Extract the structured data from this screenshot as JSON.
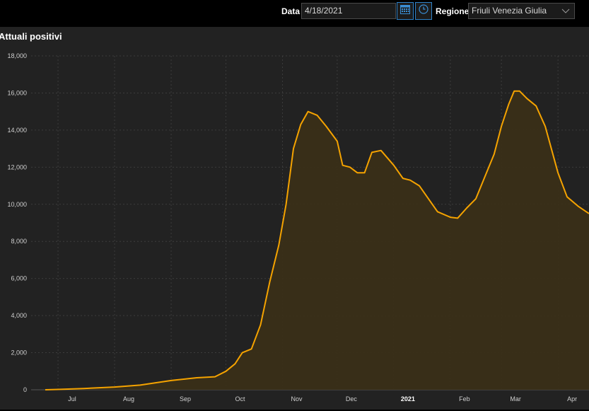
{
  "toolbar": {
    "date_label": "Data",
    "date_value": "4/18/2021",
    "region_label": "Regione",
    "region_value": "Friuli Venezia Giulia",
    "calendar_icon": "calendar-icon",
    "clock_icon": "clock-icon"
  },
  "panel": {
    "title": "Attuali positivi"
  },
  "colors": {
    "line": "#f5a300",
    "fill": "#3a2f18",
    "grid": "#3c3c3c",
    "accent": "#2f82c8"
  },
  "chart_data": {
    "type": "area",
    "title": "Attuali positivi",
    "xlabel": "",
    "ylabel": "",
    "ylim": [
      0,
      18000
    ],
    "yticks": [
      "0",
      "2,000",
      "4,000",
      "6,000",
      "8,000",
      "10,000",
      "12,000",
      "14,000",
      "16,000",
      "18,000"
    ],
    "xticks": [
      "Jul",
      "Aug",
      "Sep",
      "Oct",
      "Nov",
      "Dec",
      "2021",
      "Feb",
      "Mar",
      "Apr"
    ],
    "grid": true,
    "x": [
      "2020-06-24",
      "2020-07-01",
      "2020-07-15",
      "2020-08-01",
      "2020-08-15",
      "2020-09-01",
      "2020-09-15",
      "2020-09-25",
      "2020-10-01",
      "2020-10-06",
      "2020-10-10",
      "2020-10-15",
      "2020-10-20",
      "2020-10-25",
      "2020-10-30",
      "2020-11-03",
      "2020-11-07",
      "2020-11-11",
      "2020-11-15",
      "2020-11-20",
      "2020-11-25",
      "2020-12-01",
      "2020-12-04",
      "2020-12-08",
      "2020-12-12",
      "2020-12-16",
      "2020-12-20",
      "2020-12-25",
      "2021-01-01",
      "2021-01-06",
      "2021-01-10",
      "2021-01-15",
      "2021-01-20",
      "2021-01-25",
      "2021-02-01",
      "2021-02-05",
      "2021-02-10",
      "2021-02-15",
      "2021-02-20",
      "2021-02-25",
      "2021-03-01",
      "2021-03-05",
      "2021-03-08",
      "2021-03-11",
      "2021-03-15",
      "2021-03-20",
      "2021-03-25",
      "2021-04-01",
      "2021-04-06",
      "2021-04-12",
      "2021-04-18"
    ],
    "series": [
      {
        "values": [
          0,
          20,
          70,
          150,
          250,
          500,
          650,
          700,
          1000,
          1400,
          2000,
          2200,
          3500,
          5800,
          7800,
          10000,
          13000,
          14300,
          15000,
          14800,
          14200,
          13400,
          12100,
          12000,
          11700,
          11700,
          12800,
          12900,
          12100,
          11400,
          11300,
          11000,
          10300,
          9600,
          9300,
          9250,
          9800,
          10300,
          11500,
          12700,
          14200,
          15400,
          16100,
          16100,
          15700,
          15300,
          14200,
          11700,
          10400,
          9900,
          9500
        ]
      }
    ]
  }
}
